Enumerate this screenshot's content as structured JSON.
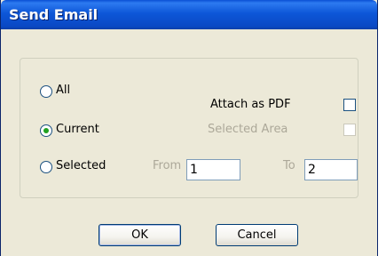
{
  "dialog": {
    "title": "Send Email"
  },
  "options": {
    "all_label": "All",
    "current_label": "Current",
    "selected_label": "Selected",
    "selected_option": "Current"
  },
  "attach": {
    "pdf_label": "Attach as PDF",
    "pdf_checked": false,
    "selected_area_label": "Selected Area",
    "selected_area_checked": false,
    "selected_area_enabled": false
  },
  "range": {
    "from_label": "From",
    "from_value": "1",
    "to_label": "To",
    "to_value": "2"
  },
  "buttons": {
    "ok_label": "OK",
    "cancel_label": "Cancel"
  },
  "colors": {
    "title_bar": "#0a4fd4",
    "dialog_bg": "#ece9d8",
    "radio_dot": "#21a121"
  }
}
